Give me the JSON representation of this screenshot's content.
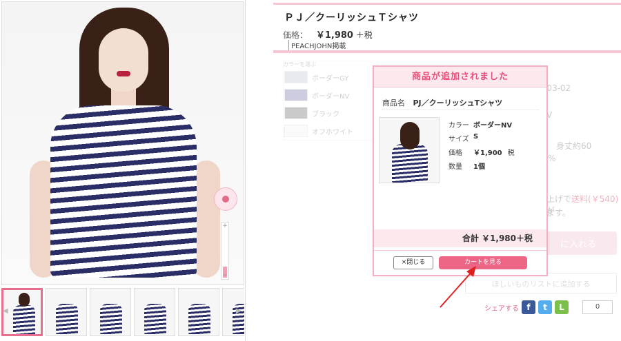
{
  "product": {
    "title": "ＰＪ／クーリッシュＴシャツ",
    "price_label": "価格：",
    "price_value": "￥1,980",
    "price_suffix": "＋税",
    "brand_tag": "PEACHJOHN掲載"
  },
  "color_selector": {
    "label": "カラーを選ぶ",
    "options": [
      {
        "name": "ボーダーGY",
        "swatch": "#c8c8d8"
      },
      {
        "name": "ボーダーNV",
        "swatch": "#7b7fb0"
      },
      {
        "name": "ブラック",
        "swatch": "#777777"
      },
      {
        "name": "オフホワイト",
        "swatch": "#f4f4f4"
      }
    ]
  },
  "background_info": {
    "date_fragment": "-03-02",
    "v_fragment": "V",
    "size_fragment": "身丈約60",
    "size_fragment_2": "%",
    "shipping_prefix": "上げで",
    "shipping_red": "送料(￥540)",
    "shipping_suffix": "が",
    "shipping_line2": "ます。",
    "cart_fragment": "に入れる",
    "wishlist": "ほしいものリストに追加する"
  },
  "share": {
    "label": "シェアする",
    "count": "0",
    "icons": [
      "facebook-icon",
      "twitter-icon",
      "line-icon"
    ]
  },
  "modal": {
    "header": "商品が追加されました",
    "name_label": "商品名",
    "name_value": "PJ／クーリッシュTシャツ",
    "details": [
      {
        "key": "カラー",
        "value": "ボーダーNV",
        "suffix": ""
      },
      {
        "key": "サイズ",
        "value": "S",
        "suffix": ""
      },
      {
        "key": "価格",
        "value": "￥1,900",
        "suffix": "税"
      },
      {
        "key": "数量",
        "value": "1個",
        "suffix": ""
      }
    ],
    "total": "合計 ￥1,980＋税",
    "close_label": "×閉じる",
    "view_cart_label": "カートを見る"
  },
  "colors": {
    "accent_pink": "#ec6585",
    "light_pink": "#fde8ee",
    "stripe_navy": "#2b2e66"
  }
}
